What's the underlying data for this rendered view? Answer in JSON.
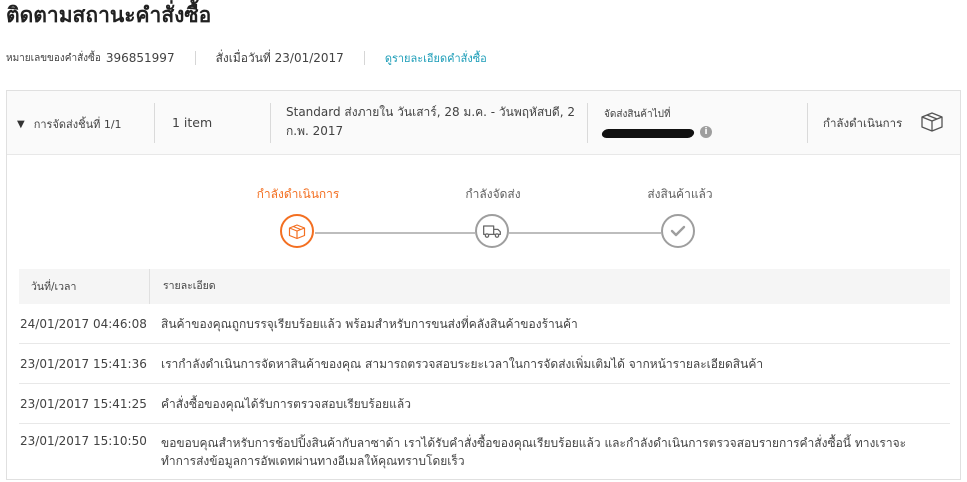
{
  "page": {
    "title": "ติดตามสถานะคำสั่งซื้อ"
  },
  "meta": {
    "order_label": "หมายเลขของคำสั่งซื้อ",
    "order_number": "396851997",
    "ordered_on": "สั่งเมื่อวันที่ 23/01/2017",
    "details_link": "ดูรายละเอียดคำสั่งซื้อ"
  },
  "package": {
    "toggle_label": "การจัดส่งชิ้นที่ 1/1",
    "item_count": "1 item",
    "shipping": "Standard ส่งภายใน วันเสาร์, 28 ม.ค. - วันพฤหัสบดี, 2 ก.พ. 2017",
    "dest_label": "จัดส่งสินค้าไปที่",
    "status": "กำลังดำเนินการ"
  },
  "tracker": {
    "steps": [
      {
        "label": "กำลังดำเนินการ",
        "icon": "box-icon",
        "active": true
      },
      {
        "label": "กำลังจัดส่ง",
        "icon": "truck-icon",
        "active": false
      },
      {
        "label": "ส่งสินค้าแล้ว",
        "icon": "check-icon",
        "active": false
      }
    ]
  },
  "log": {
    "headers": {
      "datetime": "วันที่/เวลา",
      "detail": "รายละเอียด"
    },
    "rows": [
      {
        "datetime": "24/01/2017 04:46:08",
        "detail": "สินค้าของคุณถูกบรรจุเรียบร้อยแล้ว พร้อมสำหรับการขนส่งที่คลังสินค้าของร้านค้า"
      },
      {
        "datetime": "23/01/2017 15:41:36",
        "detail": "เรากำลังดำเนินการจัดหาสินค้าของคุณ สามารถตรวจสอบระยะเวลาในการจัดส่งเพิ่มเติมได้ จากหน้ารายละเอียดสินค้า"
      },
      {
        "datetime": "23/01/2017 15:41:25",
        "detail": "คำสั่งซื้อของคุณได้รับการตรวจสอบเรียบร้อยแล้ว"
      },
      {
        "datetime": "23/01/2017 15:10:50",
        "detail": "ขอขอบคุณสำหรับการช้อปปิ้งสินค้ากับลาซาด้า เราได้รับคำสั่งซื้อของคุณเรียบร้อยแล้ว และกำลังดำเนินการตรวจสอบรายการคำสั่งซื้อนี้ ทางเราจะทำการส่งข้อมูลการอัพเดทผ่านทางอีเมลให้คุณทราบโดยเร็ว"
      }
    ]
  },
  "colors": {
    "accent": "#f36f21",
    "link": "#1a9cb7",
    "inactive": "#9e9e9e"
  }
}
